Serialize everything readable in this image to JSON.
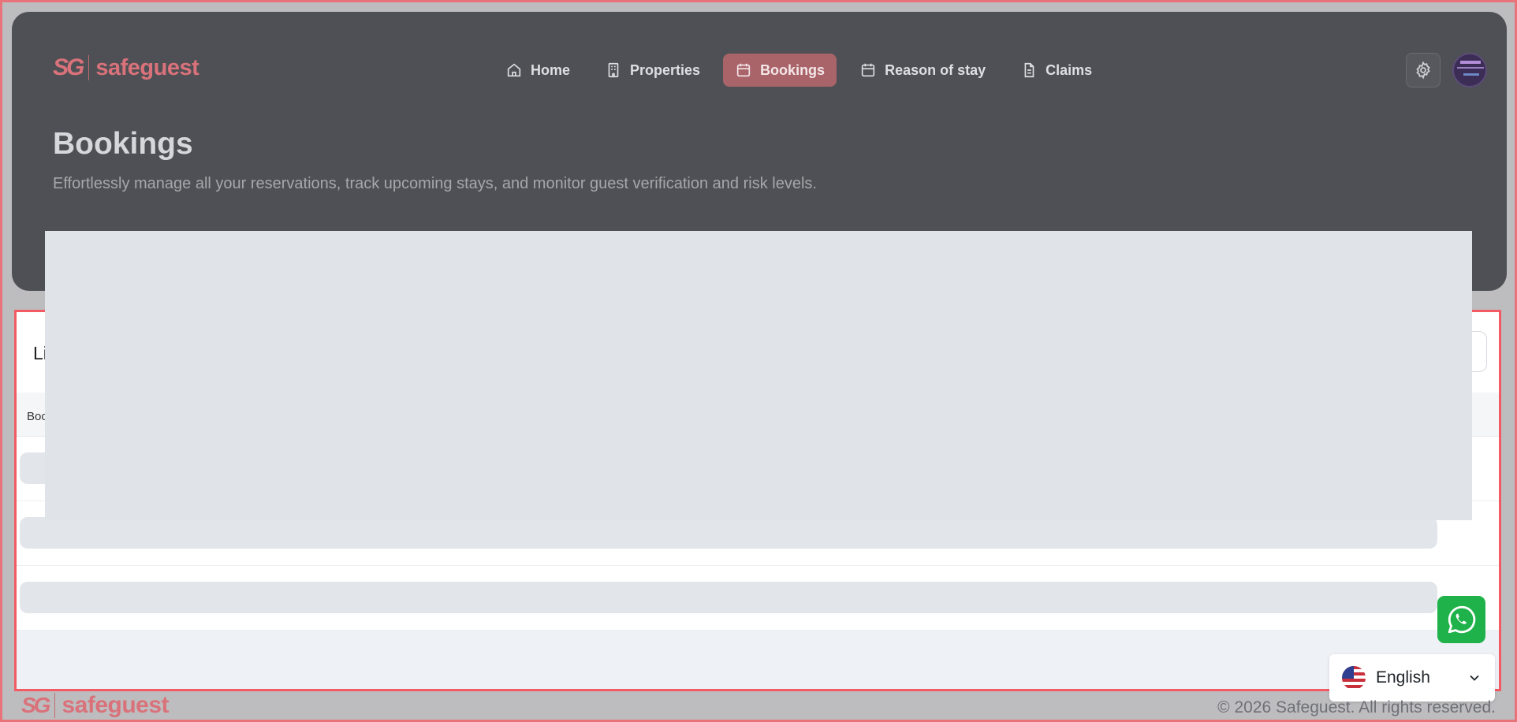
{
  "brand": {
    "mark": "SG",
    "name": "safeguest",
    "accent": "#d9727a"
  },
  "nav": {
    "items": [
      {
        "label": "Home",
        "icon": "home-icon"
      },
      {
        "label": "Properties",
        "icon": "building-icon"
      },
      {
        "label": "Bookings",
        "icon": "calendar-icon",
        "active": true
      },
      {
        "label": "Reason of stay",
        "icon": "calendar-icon"
      },
      {
        "label": "Claims",
        "icon": "document-icon"
      }
    ]
  },
  "header": {
    "title": "Bookings",
    "subtitle": "Effortlessly manage all your reservations, track upcoming stays, and monitor guest verification and risk levels."
  },
  "list": {
    "title": "Li",
    "column_first": "Boo"
  },
  "language": {
    "selected": "English"
  },
  "footer": {
    "copyright": "© 2026 Safeguest. All rights reserved."
  },
  "colors": {
    "whatsapp": "#1fb24a",
    "highlight_border": "#f25b63"
  }
}
